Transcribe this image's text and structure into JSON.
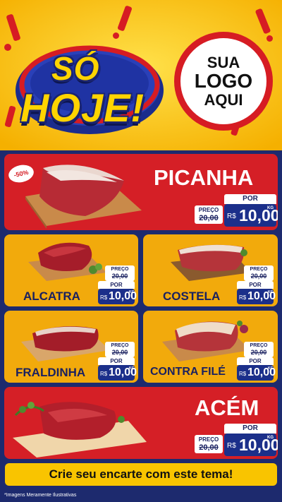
{
  "header": {
    "badge_line1": "SÓ",
    "badge_line2": "HOJE!",
    "logo_line1": "SUA",
    "logo_line2": "LOGO",
    "logo_line3": "AQUI"
  },
  "products": [
    {
      "name": "PICANHA",
      "discount": "-50%",
      "preco_label": "PREÇO",
      "old_price": "20,00",
      "por_label": "POR",
      "currency": "R$",
      "price": "10,00",
      "unit": "KG"
    },
    {
      "name": "ALCATRA",
      "preco_label": "PREÇO",
      "old_price": "20,00",
      "por_label": "POR",
      "currency": "R$",
      "price": "10,00",
      "unit": "KG"
    },
    {
      "name": "COSTELA",
      "preco_label": "PREÇO",
      "old_price": "20,00",
      "por_label": "POR",
      "currency": "R$",
      "price": "10,00",
      "unit": "KG"
    },
    {
      "name": "FRALDINHA",
      "preco_label": "PREÇO",
      "old_price": "20,00",
      "por_label": "POR",
      "currency": "R$",
      "price": "10,00",
      "unit": "KG"
    },
    {
      "name": "CONTRA FILÉ",
      "preco_label": "PREÇO",
      "old_price": "20,00",
      "por_label": "POR",
      "currency": "R$",
      "price": "10,00",
      "unit": "KG"
    },
    {
      "name": "ACÉM",
      "preco_label": "PREÇO",
      "old_price": "20,00",
      "por_label": "POR",
      "currency": "R$",
      "price": "10,00",
      "unit": "KG"
    }
  ],
  "footer": {
    "cta": "Crie seu encarte com este tema!",
    "disclaimer": "*Imagens Meramente Ilustrativas"
  },
  "colors": {
    "yellow": "#f9c400",
    "red": "#d51f26",
    "navy": "#1d2a6e",
    "price_blue": "#1b2f8a",
    "card_yellow": "#f2aa0c"
  }
}
